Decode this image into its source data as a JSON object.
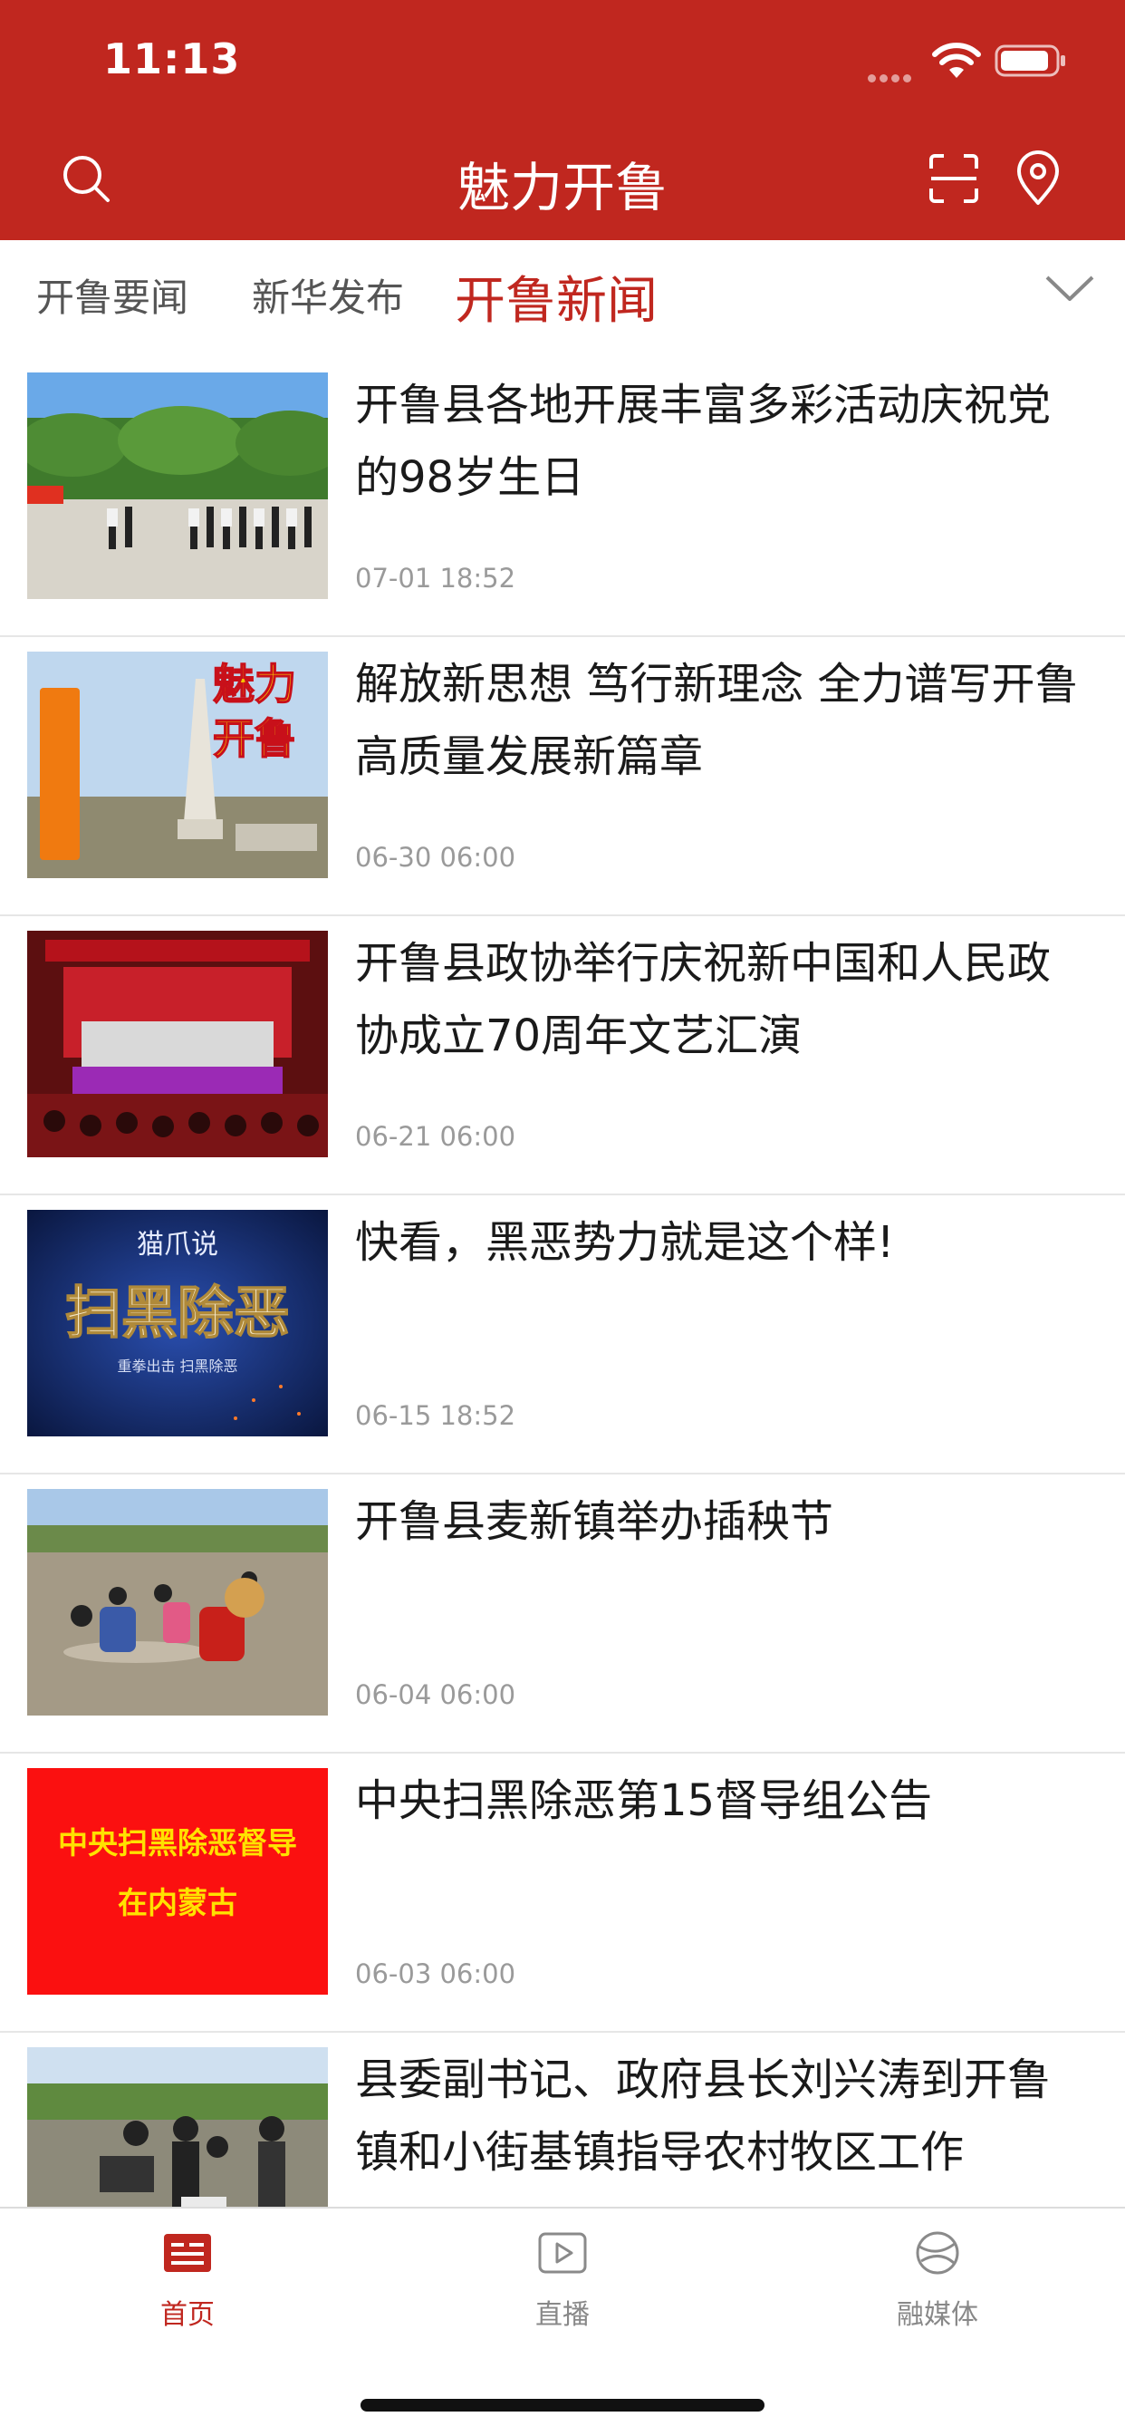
{
  "status_bar": {
    "time": "11:13"
  },
  "header": {
    "title": "魅力开鲁"
  },
  "tabs": [
    {
      "label": "开鲁要闻"
    },
    {
      "label": "新华发布"
    },
    {
      "label": "开鲁新闻"
    }
  ],
  "news": [
    {
      "title": "开鲁县各地开展丰富多彩活动庆祝党的98岁生日",
      "date": "07-01 18:52"
    },
    {
      "title": "解放新思想 笃行新理念 全力谱写开鲁高质量发展新篇章",
      "date": "06-30 06:00",
      "thumb_text": [
        "魅力",
        "开鲁"
      ]
    },
    {
      "title": "开鲁县政协举行庆祝新中国和人民政协成立70周年文艺汇演",
      "date": "06-21 06:00"
    },
    {
      "title": "快看，黑恶势力就是这个样!",
      "date": "06-15 18:52",
      "thumb_text": [
        "猫爪说",
        "扫黑除恶",
        "重拳出击 扫黑除恶"
      ]
    },
    {
      "title": "开鲁县麦新镇举办插秧节",
      "date": "06-04 06:00"
    },
    {
      "title": "中央扫黑除恶第15督导组公告",
      "date": "06-03 06:00",
      "thumb_text": [
        "中央扫黑除恶督导",
        "在内蒙古"
      ]
    },
    {
      "title": "县委副书记、政府县长刘兴涛到开鲁镇和小街基镇指导农村牧区工作",
      "date": ""
    }
  ],
  "tabbar": [
    {
      "label": "首页",
      "icon": "news-icon",
      "active": true
    },
    {
      "label": "直播",
      "icon": "play-icon",
      "active": false
    },
    {
      "label": "融媒体",
      "icon": "globe-icon",
      "active": false
    }
  ],
  "colors": {
    "brand": "#c0271f",
    "divider": "#e6e6e6",
    "muted": "#9a9a9a"
  }
}
